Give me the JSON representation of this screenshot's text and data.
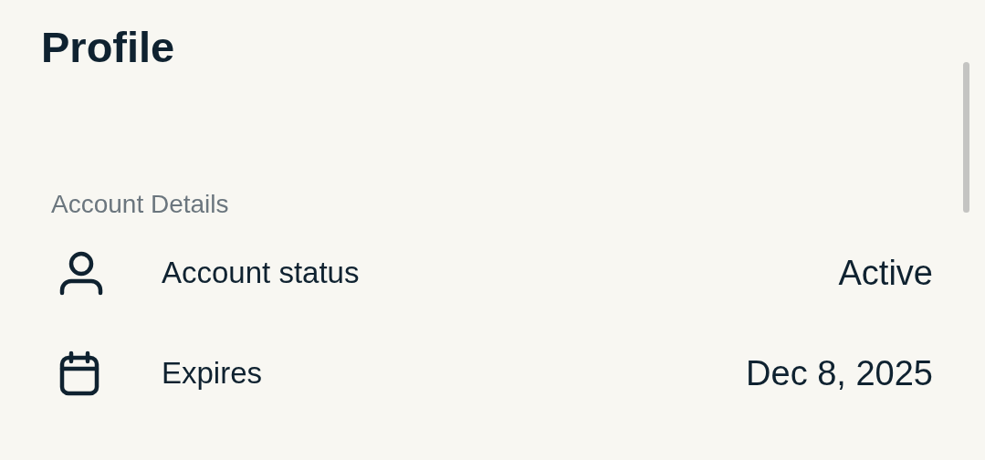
{
  "title": "Profile",
  "section": {
    "heading": "Account Details",
    "rows": [
      {
        "kind": "person",
        "label": "Account status",
        "value": "Active"
      },
      {
        "kind": "calendar",
        "label": "Expires",
        "value": "Dec 8, 2025"
      }
    ]
  }
}
